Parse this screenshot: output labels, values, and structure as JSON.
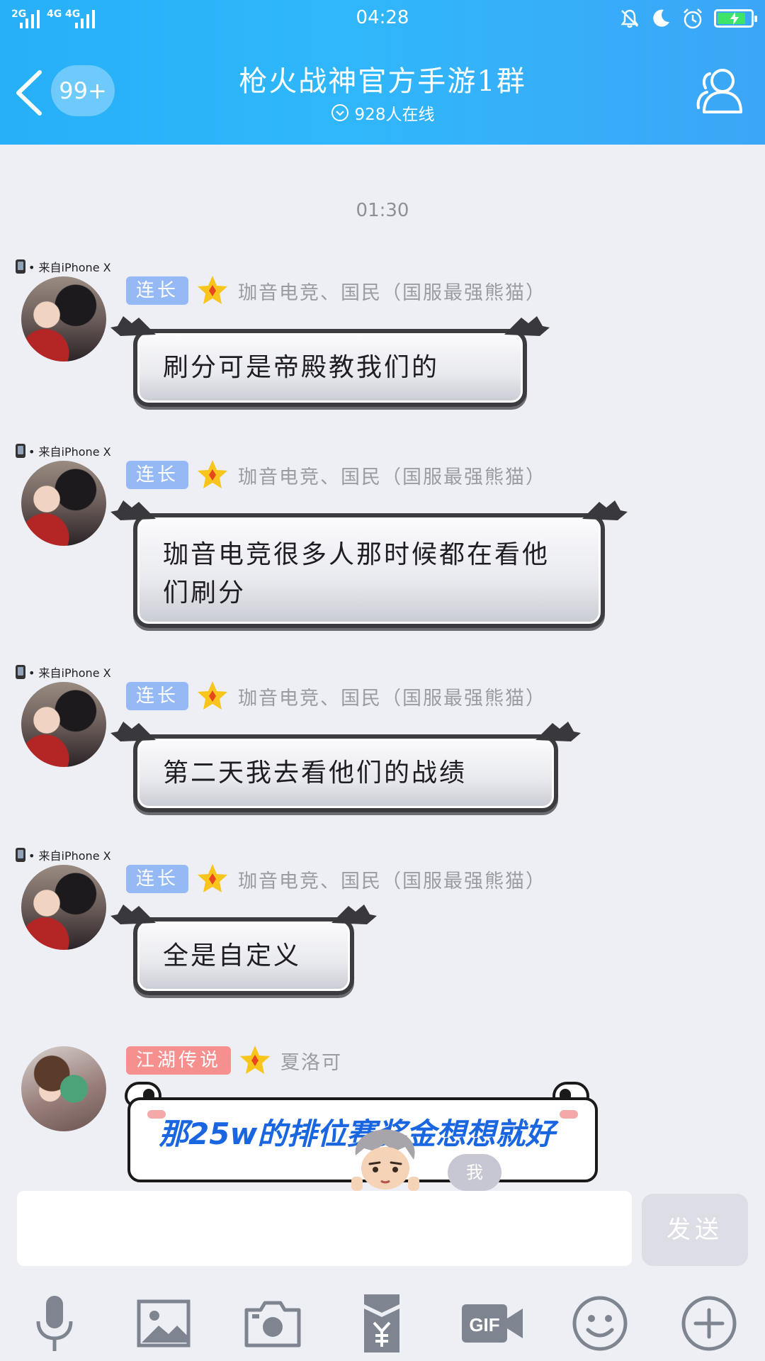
{
  "status_bar": {
    "signal_1": "2G",
    "signal_2": "4G",
    "signal_3": "4G",
    "time": "04:28",
    "battery_level": 0.85
  },
  "header": {
    "badge": "99+",
    "title": "枪火战神官方手游1群",
    "online_text": "928人在线"
  },
  "chat": {
    "timestamp": "01:30",
    "messages": [
      {
        "device": "• 来自iPhone X",
        "tag": "连长",
        "nickname": "珈音电竞、国民（国服最强熊猫）",
        "text": "刷分可是帝殿教我们的"
      },
      {
        "device": "• 来自iPhone X",
        "tag": "连长",
        "nickname": "珈音电竞、国民（国服最强熊猫）",
        "text": "珈音电竞很多人那时候都在看他们刷分"
      },
      {
        "device": "• 来自iPhone X",
        "tag": "连长",
        "nickname": "珈音电竞、国民（国服最强熊猫）",
        "text": "第二天我去看他们的战绩"
      },
      {
        "device": "• 来自iPhone X",
        "tag": "连长",
        "nickname": "珈音电竞、国民（国服最强熊猫）",
        "text": "全是自定义"
      },
      {
        "tag": "江湖传说",
        "nickname": "夏洛可",
        "text": "那25w的排位赛奖金想想就好"
      }
    ],
    "me_label": "我"
  },
  "input": {
    "value": "",
    "send_label": "发送"
  },
  "colors": {
    "header_gradient_start": "#27b0f7",
    "header_gradient_end": "#3ca6f6",
    "tag_blue": "#94b9f4",
    "tag_red": "#f6908e",
    "background": "#eeeff5"
  },
  "toolbar_icons": [
    "microphone-icon",
    "image-icon",
    "camera-icon",
    "red-packet-icon",
    "gif-icon",
    "emoji-icon",
    "plus-icon"
  ]
}
